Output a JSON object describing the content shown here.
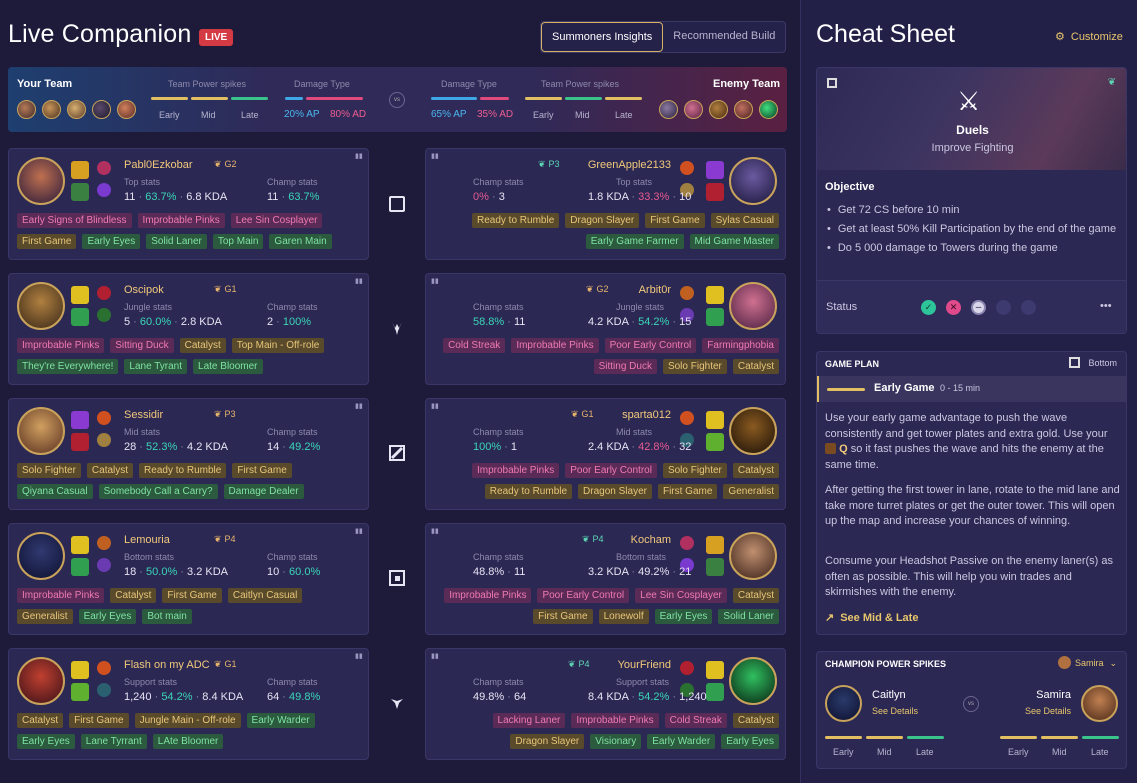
{
  "header": {
    "title": "Live Companion",
    "live_badge": "LIVE",
    "tabs": [
      "Summoners Insights",
      "Recommended Build"
    ],
    "active_tab": "Summoners Insights"
  },
  "team_summary": {
    "your_team": "Your Team",
    "enemy_team": "Enemy Team",
    "power_spikes_label": "Team Power spikes",
    "damage_type_label": "Damage Type",
    "phases": [
      "Early",
      "Mid",
      "Late"
    ],
    "your_damage": {
      "ap": "20% AP",
      "ad": "80% AD"
    },
    "enemy_damage": {
      "ap": "65% AP",
      "ad": "35% AD"
    },
    "vs": "vs"
  },
  "ally_cards": [
    {
      "name": "Pabl0Ezkobar",
      "rank": "G2",
      "stats_left_label": "Top stats",
      "stats_right_label": "Champ stats",
      "left_games": "11",
      "left_wr": "63.7%",
      "left_kda": "6.8 KDA",
      "right_games": "11",
      "right_wr": "63.7%",
      "tags": [
        [
          "Early Signs of Blindless",
          "pink"
        ],
        [
          "Improbable Pinks",
          "pink"
        ],
        [
          "Lee Sin Cosplayer",
          "pink"
        ],
        [
          "First Game",
          "gold"
        ],
        [
          "Early Eyes",
          "green"
        ],
        [
          "Solid Laner",
          "green"
        ],
        [
          "Top Main",
          "green"
        ],
        [
          "Garen Main",
          "green"
        ]
      ]
    },
    {
      "name": "Oscipok",
      "rank": "G1",
      "stats_left_label": "Jungle stats",
      "stats_right_label": "Champ stats",
      "left_games": "5",
      "left_wr": "60.0%",
      "left_kda": "2.8 KDA",
      "right_games": "2",
      "right_wr": "100%",
      "tags": [
        [
          "Improbable Pinks",
          "pink"
        ],
        [
          "Sitting Duck",
          "pink"
        ],
        [
          "Catalyst",
          "gold"
        ],
        [
          "Top Main - Off-role",
          "gold"
        ],
        [
          "They're Everywhere!",
          "green"
        ],
        [
          "Lane Tyrant",
          "green"
        ],
        [
          "Late Bloomer",
          "green"
        ]
      ]
    },
    {
      "name": "Sessidir",
      "rank": "P3",
      "stats_left_label": "Mid stats",
      "stats_right_label": "Champ stats",
      "left_games": "28",
      "left_wr": "52.3%",
      "left_kda": "4.2 KDA",
      "right_games": "14",
      "right_wr": "49.2%",
      "tags": [
        [
          "Solo Fighter",
          "gold"
        ],
        [
          "Catalyst",
          "gold"
        ],
        [
          "Ready to Rumble",
          "gold"
        ],
        [
          "First Game",
          "gold"
        ],
        [
          "Qiyana Casual",
          "green"
        ],
        [
          "Somebody Call a Carry?",
          "green"
        ],
        [
          "Damage Dealer",
          "green"
        ]
      ]
    },
    {
      "name": "Lemouria",
      "rank": "P4",
      "stats_left_label": "Bottom stats",
      "stats_right_label": "Champ stats",
      "left_games": "18",
      "left_wr": "50.0%",
      "left_kda": "3.2 KDA",
      "right_games": "10",
      "right_wr": "60.0%",
      "tags": [
        [
          "Improbable Pinks",
          "pink"
        ],
        [
          "Catalyst",
          "gold"
        ],
        [
          "First Game",
          "gold"
        ],
        [
          "Caitlyn Casual",
          "gold"
        ],
        [
          "Generalist",
          "gold"
        ],
        [
          "Early Eyes",
          "green"
        ],
        [
          "Bot main",
          "green"
        ]
      ]
    },
    {
      "name": "Flash on my ADC",
      "rank": "G1",
      "stats_left_label": "Support stats",
      "stats_right_label": "Champ stats",
      "left_games": "1,240",
      "left_wr": "54.2%",
      "left_kda": "8.4 KDA",
      "right_games": "64",
      "right_wr": "49.8%",
      "tags": [
        [
          "Catalyst",
          "gold"
        ],
        [
          "First Game",
          "gold"
        ],
        [
          "Jungle Main - Off-role",
          "gold"
        ],
        [
          "Early Warder",
          "green"
        ],
        [
          "Early Eyes",
          "green"
        ],
        [
          "Lane Tyrrant",
          "green"
        ],
        [
          "LAte Bloomer",
          "green"
        ]
      ]
    }
  ],
  "enemy_cards": [
    {
      "name": "GreenApple2133",
      "rank": "P3",
      "stats_left_label": "Champ stats",
      "stats_right_label": "Top stats",
      "left_wr": "0%",
      "left_games": "3",
      "right_kda": "1.8 KDA",
      "right_wr": "33.3%",
      "right_games": "10",
      "tags": [
        [
          "Ready to Rumble",
          "gold"
        ],
        [
          "Dragon Slayer",
          "gold"
        ],
        [
          "First Game",
          "gold"
        ],
        [
          "Sylas Casual",
          "gold"
        ],
        [
          "Early Game Farmer",
          "green"
        ],
        [
          "Mid Game Master",
          "green"
        ]
      ]
    },
    {
      "name": "Arbit0r",
      "rank": "G2",
      "stats_left_label": "Champ stats",
      "stats_right_label": "Jungle stats",
      "left_wr": "58.8%",
      "left_games": "11",
      "right_kda": "4.2 KDA",
      "right_wr": "54.2%",
      "right_games": "15",
      "tags": [
        [
          "Cold Streak",
          "pink"
        ],
        [
          "Improbable Pinks",
          "pink"
        ],
        [
          "Poor Early Control",
          "pink"
        ],
        [
          "Farmingphobia",
          "pink"
        ],
        [
          "Sitting Duck",
          "pink"
        ],
        [
          "Solo Fighter",
          "gold"
        ],
        [
          "Catalyst",
          "gold"
        ]
      ]
    },
    {
      "name": "sparta012",
      "rank": "G1",
      "stats_left_label": "Champ stats",
      "stats_right_label": "Mid stats",
      "left_wr": "100%",
      "left_games": "1",
      "right_kda": "2.4 KDA",
      "right_wr": "42.8%",
      "right_games": "32",
      "tags": [
        [
          "Improbable Pinks",
          "pink"
        ],
        [
          "Poor Early Control",
          "pink"
        ],
        [
          "Solo Fighter",
          "gold"
        ],
        [
          "Catalyst",
          "gold"
        ],
        [
          "Ready to Rumble",
          "gold"
        ],
        [
          "Dragon Slayer",
          "gold"
        ],
        [
          "First Game",
          "gold"
        ],
        [
          "Generalist",
          "gold"
        ]
      ]
    },
    {
      "name": "Kocham",
      "rank": "P4",
      "stats_left_label": "Champ stats",
      "stats_right_label": "Bottom stats",
      "left_wr": "48.8%",
      "left_games": "11",
      "right_kda": "3.2 KDA",
      "right_wr": "49.2%",
      "right_games": "21",
      "tags": [
        [
          "Improbable Pinks",
          "pink"
        ],
        [
          "Poor Early Control",
          "pink"
        ],
        [
          "Lee Sin Cosplayer",
          "pink"
        ],
        [
          "Catalyst",
          "gold"
        ],
        [
          "First Game",
          "gold"
        ],
        [
          "Lonewolf",
          "gold"
        ],
        [
          "Early Eyes",
          "green"
        ],
        [
          "Solid Laner",
          "green"
        ]
      ]
    },
    {
      "name": "YourFriend",
      "rank": "P4",
      "stats_left_label": "Champ stats",
      "stats_right_label": "Support stats",
      "left_wr": "49.8%",
      "left_games": "64",
      "right_kda": "8.4 KDA",
      "right_wr": "54.2%",
      "right_games": "1,240",
      "tags": [
        [
          "Lacking Laner",
          "pink"
        ],
        [
          "Improbable Pinks",
          "pink"
        ],
        [
          "Cold Streak",
          "pink"
        ],
        [
          "Catalyst",
          "gold"
        ],
        [
          "Dragon Slayer",
          "gold"
        ],
        [
          "Visionary",
          "green"
        ],
        [
          "Early Warder",
          "green"
        ],
        [
          "Early Eyes",
          "green"
        ]
      ]
    }
  ],
  "cheat_sheet": {
    "title": "Cheat Sheet",
    "customize": "Customize",
    "duel_title": "Duels",
    "duel_subtitle": "Improve Fighting",
    "objective_label": "Objective",
    "objectives": [
      "Get 72 CS before 10 min",
      "Get at least 50% Kill Participation by the end of the game",
      "Do 5 000 damage to Towers during the game"
    ],
    "status_label": "Status",
    "more": "•••"
  },
  "game_plan": {
    "label": "GAME PLAN",
    "lane": "Bottom",
    "phase": "Early Game",
    "phase_time": "0 - 15 min",
    "p1_a": "Use your early game advantage to push the wave consistently and get tower plates and extra gold. Use your",
    "p1_key": "Q",
    "p1_b": "so it fast pushes the wave and hits the enemy at the same time.",
    "p2": "After getting the first tower in lane, rotate to the mid lane and take more turret plates or get the outer tower. This will open up the map and increase your chances of winning.",
    "p3": "Consume your Headshot Passive on the enemy laner(s) as often as possible. This will help you win trades and skirmishes with the enemy.",
    "link": "See Mid & Late"
  },
  "power_spikes": {
    "label": "CHAMPION POWER SPIKES",
    "selected": "Samira",
    "left_name": "Caitlyn",
    "right_name": "Samira",
    "details": "See Details",
    "vs": "vs",
    "phases": [
      "Early",
      "Mid",
      "Late"
    ]
  },
  "colors": {
    "gold": "#e2c062",
    "ap": "#3fa7e6",
    "ad": "#e0497c",
    "late": "#3ac48c",
    "pct_ok": "#3ad6b7",
    "pct_bad": "#e75a8f"
  }
}
